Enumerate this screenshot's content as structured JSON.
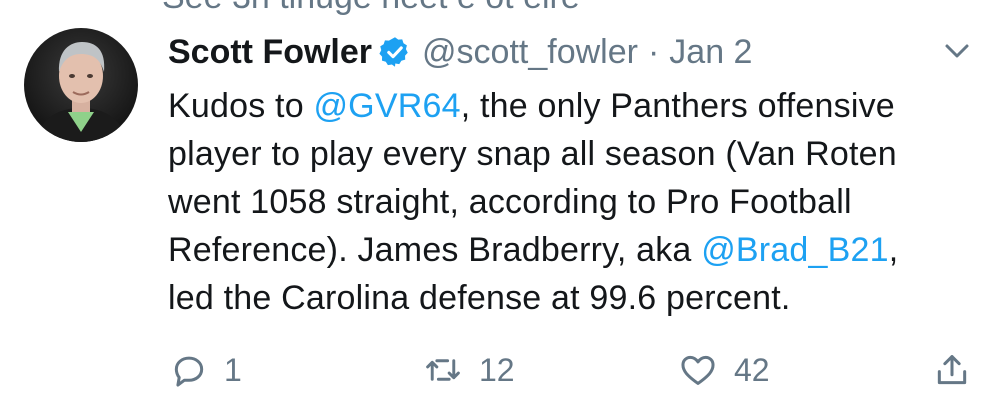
{
  "previous_tweet_fragment": "See 3n tinuge heet e ot eire",
  "tweet": {
    "author_name": "Scott Fowler",
    "author_handle": "@scott_fowler",
    "separator": "·",
    "date": "Jan 2",
    "text": {
      "l1_a": "Kudos to ",
      "l1_mention": "@GVR64",
      "l1_b": ", the only Panthers offensive",
      "l2": "player to play every snap all season (Van Roten",
      "l3": "went 1058 straight, according to Pro Football",
      "l4_a": "Reference). James Bradberry, aka ",
      "l4_mention": "@Brad_B21",
      "l4_b": ",",
      "l5": "led the Carolina defense at 99.6 percent."
    },
    "actions": {
      "replies": "1",
      "retweets": "12",
      "likes": "42"
    }
  },
  "colors": {
    "link": "#1da1f2",
    "secondary_text": "#657786",
    "primary_text": "#14171a",
    "verified_badge": "#1da1f2"
  },
  "icons": {
    "verified": "verified-badge-icon",
    "menu": "chevron-down-icon",
    "reply": "reply-bubble-icon",
    "retweet": "retweet-arrows-icon",
    "like": "heart-outline-icon",
    "share": "share-upload-icon"
  }
}
